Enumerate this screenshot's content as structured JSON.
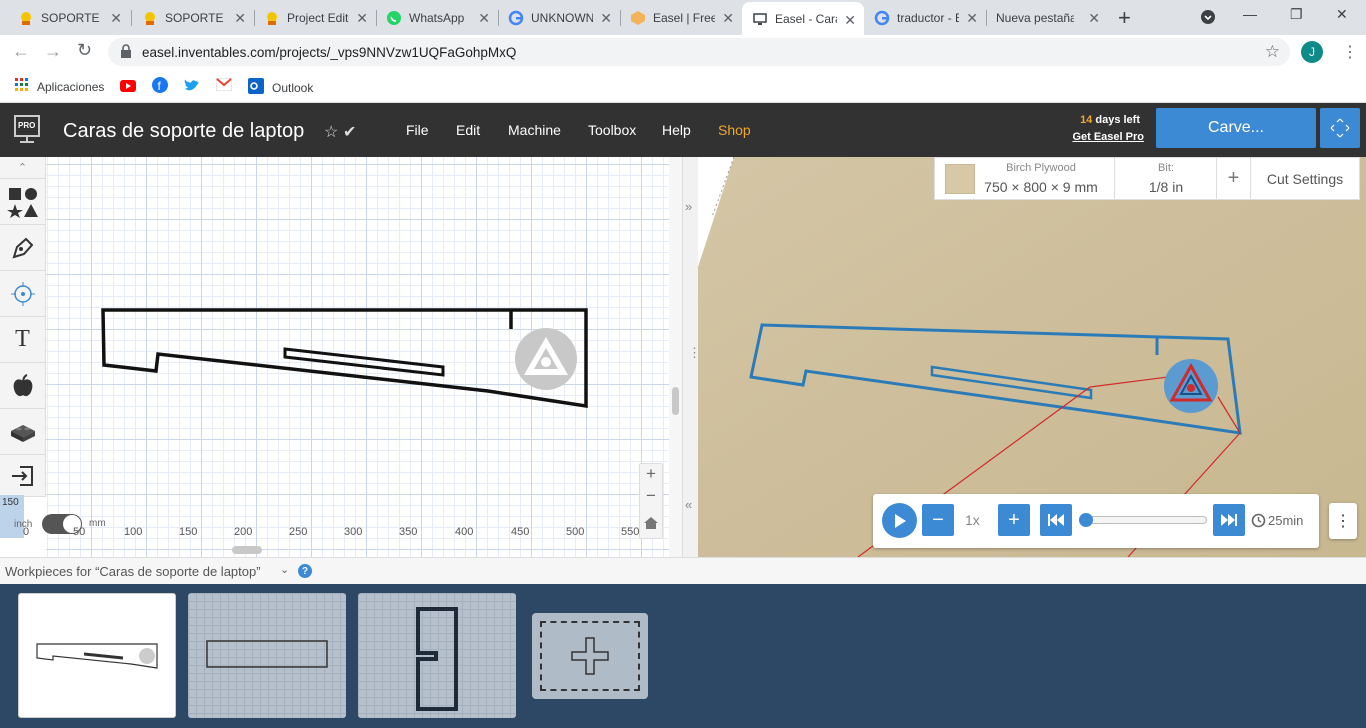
{
  "browser": {
    "tabs": [
      {
        "title": "SOPORTE DE",
        "icon": "instructables-icon",
        "active": false
      },
      {
        "title": "SOPORTE DE",
        "icon": "instructables-icon",
        "active": false
      },
      {
        "title": "Project Editor",
        "icon": "instructables-icon",
        "active": false
      },
      {
        "title": "WhatsApp",
        "icon": "whatsapp-icon",
        "active": false
      },
      {
        "title": "UNKNOWN",
        "icon": "google-icon",
        "active": false
      },
      {
        "title": "Easel | Free",
        "icon": "easel-icon",
        "active": false
      },
      {
        "title": "Easel - Caras",
        "icon": "monitor-icon",
        "active": true
      },
      {
        "title": "traductor - B",
        "icon": "google-icon",
        "active": false
      },
      {
        "title": "Nueva pestaña",
        "icon": "",
        "active": false
      }
    ],
    "url": "easel.inventables.com/projects/_vps9NNVzw1UQFaGohpMxQ",
    "profile_initial": "J",
    "bookmarks": [
      "Aplicaciones",
      "Outlook"
    ]
  },
  "app": {
    "logo": "PRO",
    "project_title": "Caras de soporte de laptop",
    "menu": [
      "File",
      "Edit",
      "Machine",
      "Toolbox",
      "Help",
      "Shop"
    ],
    "trial_days": "14",
    "trial_text": " days left",
    "get_pro": "Get Easel Pro",
    "carve_label": "Carve..."
  },
  "material": {
    "name": "Birch Plywood",
    "dimensions": "750 × 800 × 9 mm",
    "bit_label": "Bit:",
    "bit_value": "1/8 in",
    "add": "+",
    "cut_settings": "Cut Settings"
  },
  "canvas": {
    "ruler_x": [
      "0",
      "50",
      "100",
      "150",
      "200",
      "250",
      "300",
      "350",
      "400",
      "450",
      "500",
      "550"
    ],
    "ruler_y_visible": "150",
    "unit_inch": "inch",
    "unit_mm": "mm",
    "zoom_in": "+",
    "zoom_out": "−"
  },
  "playback": {
    "speed": "1x",
    "time": "25min",
    "progress": 0.0
  },
  "workpieces": {
    "label": "Workpieces for “Caras de soporte de laptop”",
    "count_visible": 3
  },
  "colors": {
    "accent": "#3c8ad4",
    "header": "#323232",
    "tray": "#2d4864",
    "toolpath": "#2b7bb9",
    "travel": "#d12a2a",
    "shop": "#f0a830"
  }
}
